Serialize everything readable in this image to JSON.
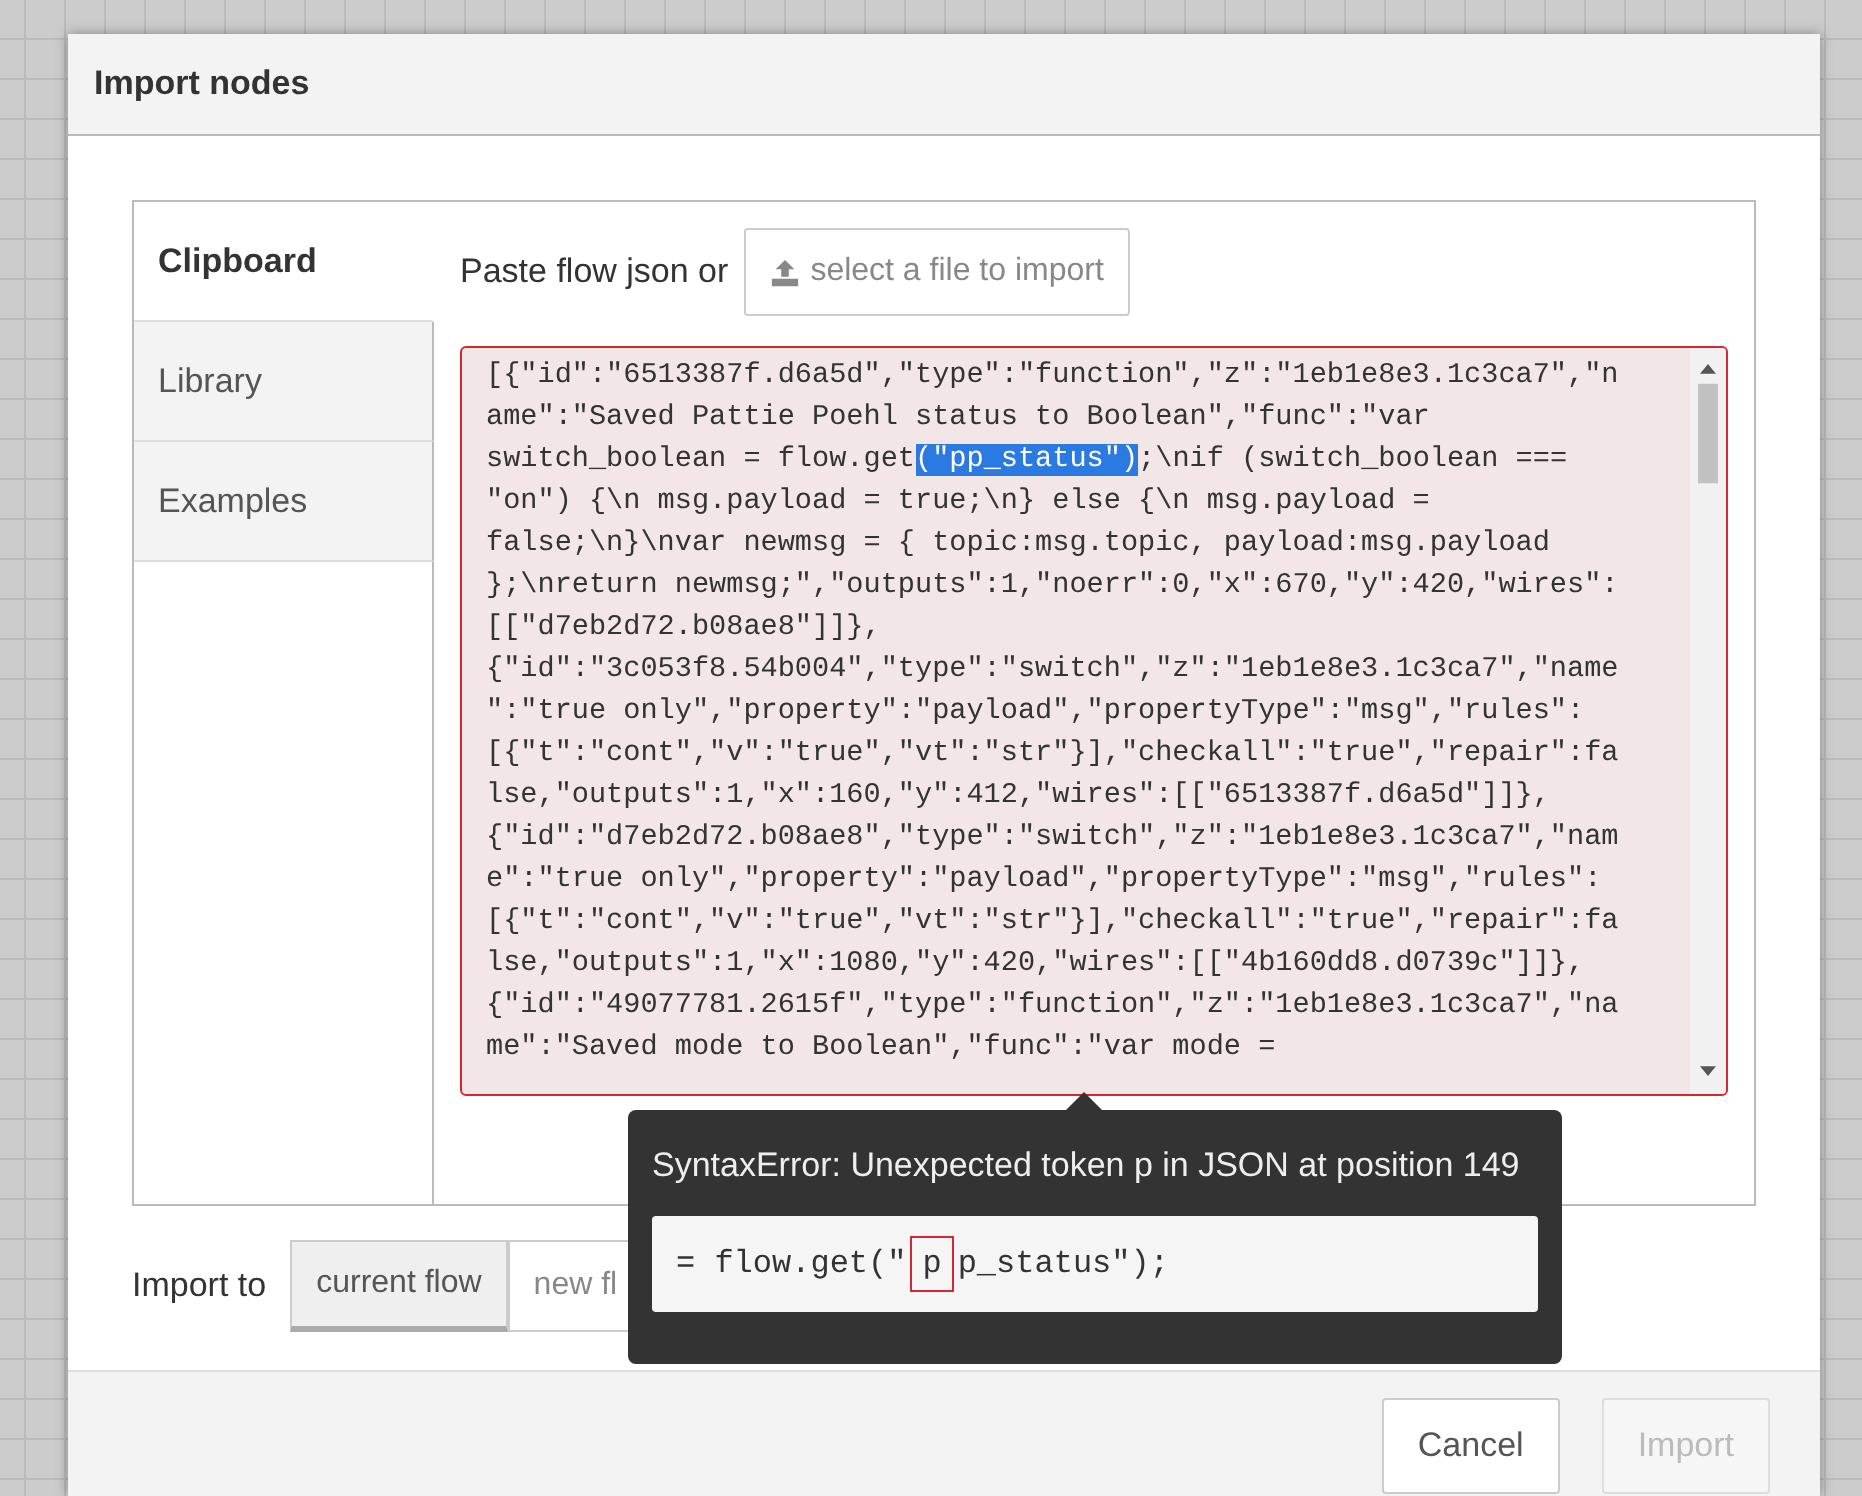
{
  "dialog": {
    "title": "Import nodes"
  },
  "tabs": [
    {
      "label": "Clipboard",
      "selected": true
    },
    {
      "label": "Library",
      "selected": false
    },
    {
      "label": "Examples",
      "selected": false
    }
  ],
  "clipboard": {
    "prompt": "Paste flow json or",
    "file_button": "select a file to import",
    "editor": {
      "error": true,
      "lines": [
        [
          {
            "text": "[{\"id\":\"6513387f.d6a5d\",\"type\":\"function\",\"z\":\"1eb1e8e3.1c3ca7\",\"n",
            "selected": false
          }
        ],
        [
          {
            "text": "ame\":\"Saved Pattie Poehl status to Boolean\",\"func\":\"var",
            "selected": false
          }
        ],
        [
          {
            "text": "switch_boolean = flow.get",
            "selected": false
          },
          {
            "text": "(\"pp_status\")",
            "selected": true
          },
          {
            "text": ";\\nif (switch_boolean ===",
            "selected": false
          }
        ],
        [
          {
            "text": "\"on\") {\\n msg.payload = true;\\n} else {\\n msg.payload =",
            "selected": false
          }
        ],
        [
          {
            "text": "false;\\n}\\nvar newmsg = { topic:msg.topic, payload:msg.payload",
            "selected": false
          }
        ],
        [
          {
            "text": "};\\nreturn newmsg;\",\"outputs\":1,\"noerr\":0,\"x\":670,\"y\":420,\"wires\":",
            "selected": false
          }
        ],
        [
          {
            "text": "[[\"d7eb2d72.b08ae8\"]]},",
            "selected": false
          }
        ],
        [
          {
            "text": "{\"id\":\"3c053f8.54b004\",\"type\":\"switch\",\"z\":\"1eb1e8e3.1c3ca7\",\"name",
            "selected": false
          }
        ],
        [
          {
            "text": "\":\"true only\",\"property\":\"payload\",\"propertyType\":\"msg\",\"rules\":",
            "selected": false
          }
        ],
        [
          {
            "text": "[{\"t\":\"cont\",\"v\":\"true\",\"vt\":\"str\"}],\"checkall\":\"true\",\"repair\":fa",
            "selected": false
          }
        ],
        [
          {
            "text": "lse,\"outputs\":1,\"x\":160,\"y\":412,\"wires\":[[\"6513387f.d6a5d\"]]},",
            "selected": false
          }
        ],
        [
          {
            "text": "{\"id\":\"d7eb2d72.b08ae8\",\"type\":\"switch\",\"z\":\"1eb1e8e3.1c3ca7\",\"nam",
            "selected": false
          }
        ],
        [
          {
            "text": "e\":\"true only\",\"property\":\"payload\",\"propertyType\":\"msg\",\"rules\":",
            "selected": false
          }
        ],
        [
          {
            "text": "[{\"t\":\"cont\",\"v\":\"true\",\"vt\":\"str\"}],\"checkall\":\"true\",\"repair\":fa",
            "selected": false
          }
        ],
        [
          {
            "text": "lse,\"outputs\":1,\"x\":1080,\"y\":420,\"wires\":[[\"4b160dd8.d0739c\"]]},",
            "selected": false
          }
        ],
        [
          {
            "text": "{\"id\":\"49077781.2615f\",\"type\":\"function\",\"z\":\"1eb1e8e3.1c3ca7\",\"na",
            "selected": false
          }
        ],
        [
          {
            "text": "me\":\"Saved mode to Boolean\",\"func\":\"var mode =",
            "selected": false
          }
        ]
      ]
    }
  },
  "import_to": {
    "label": "Import to",
    "options": [
      {
        "label": "current flow",
        "selected": true
      },
      {
        "label": "new fl",
        "selected": false
      }
    ]
  },
  "error_tooltip": {
    "message": "SyntaxError: Unexpected token p in JSON at position 149",
    "excerpt": {
      "before": "= flow.get(\"",
      "marked": "p",
      "after": "p_status\");"
    }
  },
  "buttons": [
    {
      "label": "Cancel",
      "disabled": false
    },
    {
      "label": "Import",
      "disabled": true
    }
  ]
}
